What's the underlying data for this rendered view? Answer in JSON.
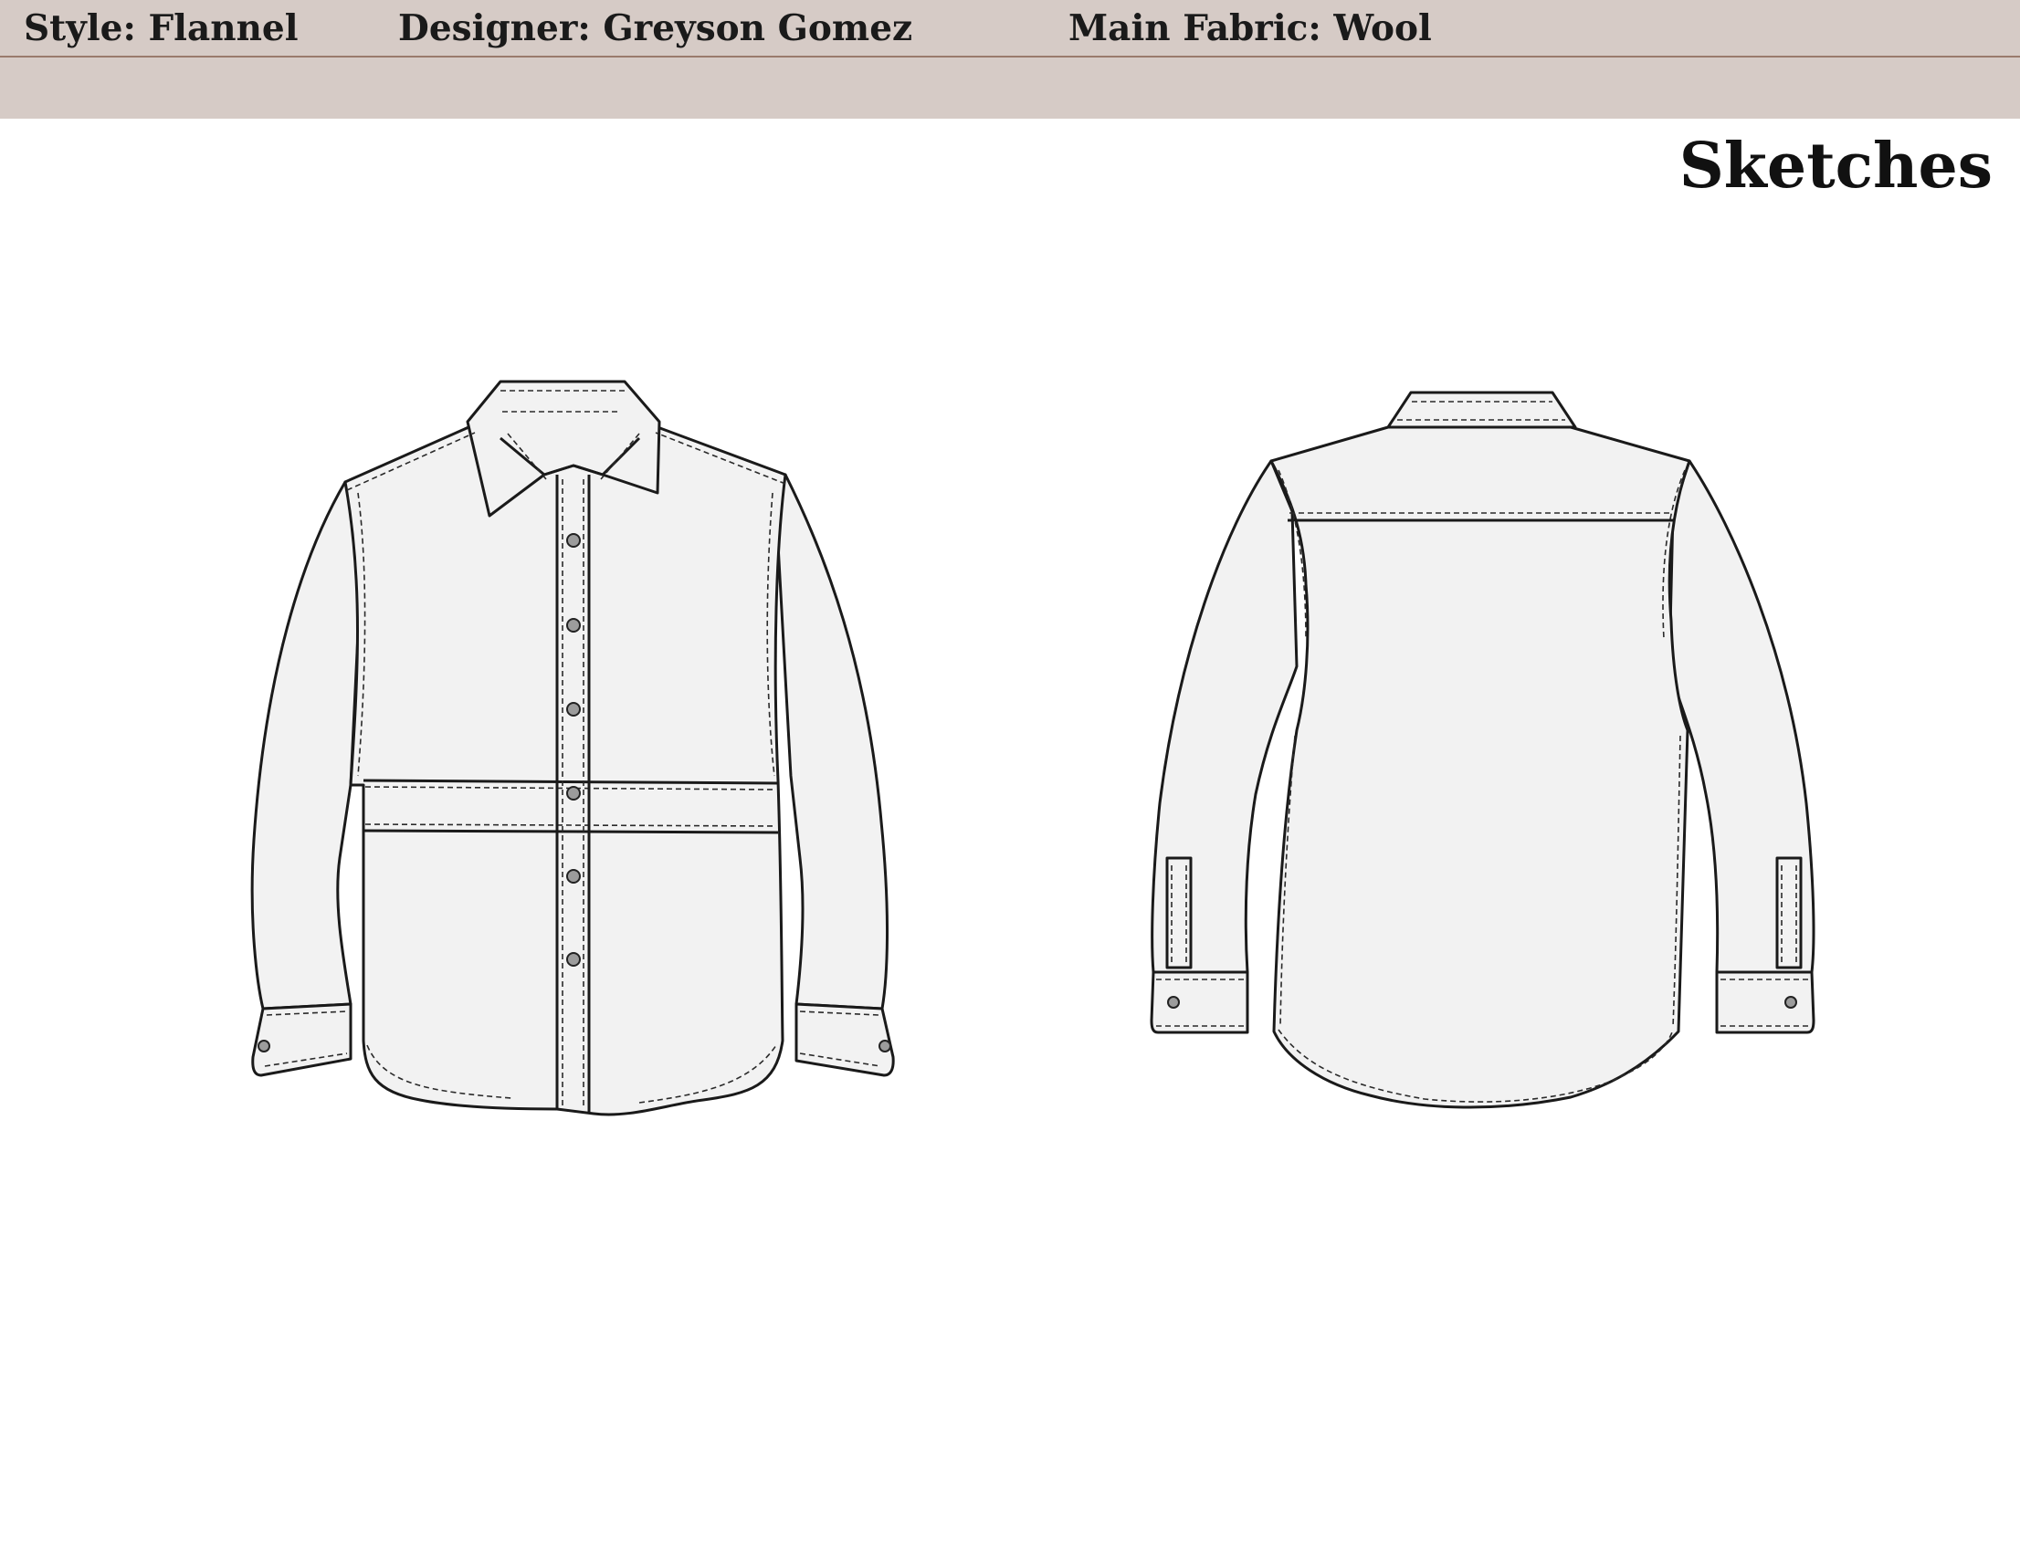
{
  "header": {
    "style_label": "Style",
    "style_value": "Flannel",
    "designer_label": "Designer",
    "designer_value": "Greyson Gomez",
    "fabric_label": "Main Fabric",
    "fabric_value": "Wool"
  },
  "page_title": "Sketches",
  "colors": {
    "header_band": "#d6cbc6",
    "header_rule": "#9a7a6c",
    "garment_fill": "#f2f2f2",
    "outline": "#1a1a1a",
    "button": "#9c9c9c"
  }
}
